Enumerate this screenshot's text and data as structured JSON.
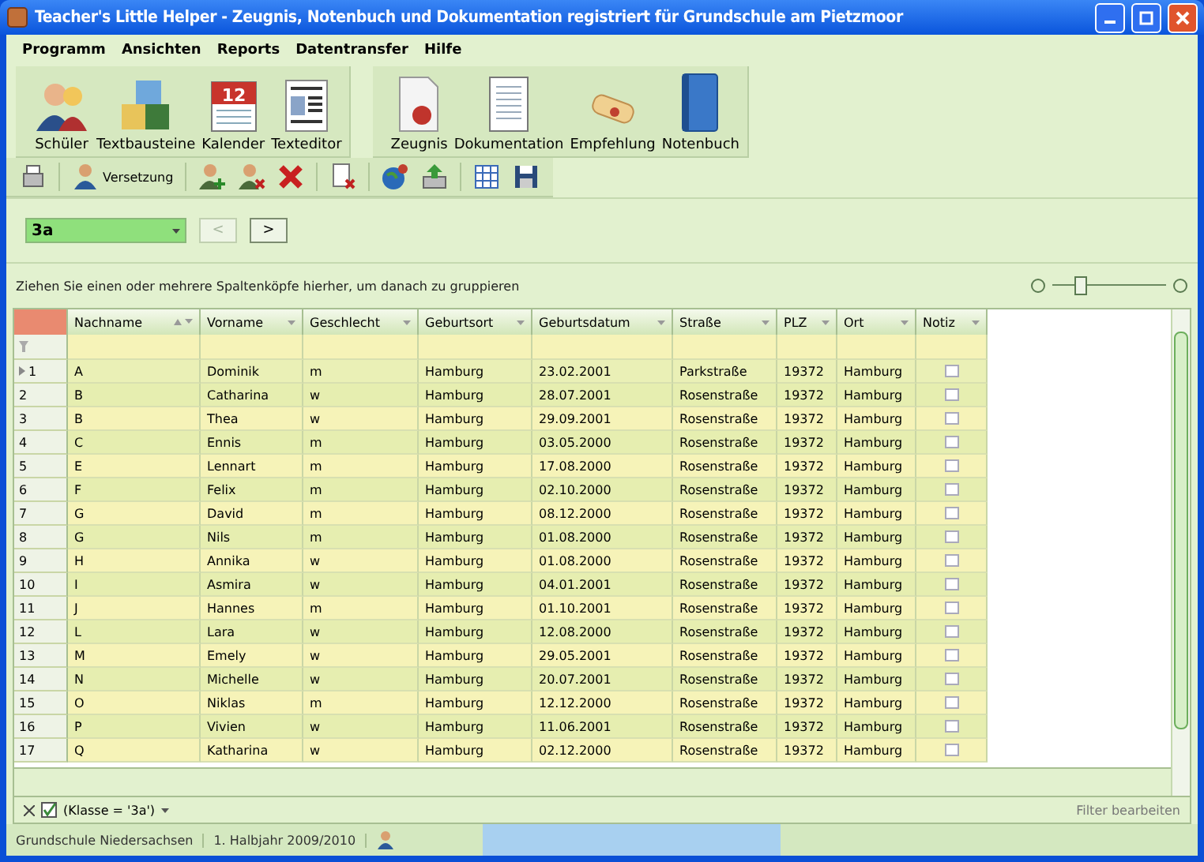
{
  "window": {
    "title": "Teacher's Little Helper - Zeugnis, Notenbuch und Dokumentation registriert für Grundschule am Pietzmoor"
  },
  "menu": [
    "Programm",
    "Ansichten",
    "Reports",
    "Datentransfer",
    "Hilfe"
  ],
  "toolbar_groups": [
    [
      {
        "label": "Schüler"
      },
      {
        "label": "Textbausteine"
      },
      {
        "label": "Kalender",
        "badge": "12"
      },
      {
        "label": "Texteditor"
      }
    ],
    [
      {
        "label": "Zeugnis"
      },
      {
        "label": "Dokumentation"
      },
      {
        "label": "Empfehlung"
      },
      {
        "label": "Notenbuch"
      }
    ]
  ],
  "small_toolbar": [
    {
      "kind": "icon"
    },
    {
      "kind": "labeled",
      "label": "Versetzung"
    },
    {
      "kind": "icon"
    },
    {
      "kind": "icon"
    },
    {
      "kind": "icon"
    },
    {
      "kind": "icon"
    },
    {
      "kind": "icon"
    },
    {
      "kind": "icon"
    },
    {
      "kind": "icon"
    },
    {
      "kind": "icon"
    }
  ],
  "class_selector": {
    "value": "3a",
    "prev": {
      "label": "<",
      "disabled": true
    },
    "next": {
      "label": ">",
      "disabled": false
    }
  },
  "group_panel": {
    "hint": "Ziehen Sie einen oder mehrere Spaltenköpfe hierher, um danach zu gruppieren"
  },
  "zoom_slider": {
    "level": 0.25
  },
  "table": {
    "columns": [
      {
        "label": "Nachname",
        "sorted": true
      },
      {
        "label": "Vorname",
        "sorted": false
      },
      {
        "label": "Geschlecht",
        "sorted": false
      },
      {
        "label": "Geburtsort",
        "sorted": false
      },
      {
        "label": "Geburtsdatum",
        "sorted": false
      },
      {
        "label": "Straße",
        "sorted": false
      },
      {
        "label": "PLZ",
        "sorted": false
      },
      {
        "label": "Ort",
        "sorted": false
      },
      {
        "label": "Notiz",
        "sorted": false
      }
    ],
    "rows": [
      {
        "number": "1",
        "current": true,
        "cells": [
          "A",
          "Dominik",
          "m",
          "Hamburg",
          "23.02.2001",
          "Parkstraße",
          "19372",
          "Hamburg"
        ]
      },
      {
        "number": "2",
        "current": false,
        "cells": [
          "B",
          "Catharina",
          "w",
          "Hamburg",
          "28.07.2001",
          "Rosenstraße",
          "19372",
          "Hamburg"
        ]
      },
      {
        "number": "3",
        "current": false,
        "cells": [
          "B",
          "Thea",
          "w",
          "Hamburg",
          "29.09.2001",
          "Rosenstraße",
          "19372",
          "Hamburg"
        ]
      },
      {
        "number": "4",
        "current": false,
        "cells": [
          "C",
          "Ennis",
          "m",
          "Hamburg",
          "03.05.2000",
          "Rosenstraße",
          "19372",
          "Hamburg"
        ]
      },
      {
        "number": "5",
        "current": false,
        "cells": [
          "E",
          "Lennart",
          "m",
          "Hamburg",
          "17.08.2000",
          "Rosenstraße",
          "19372",
          "Hamburg"
        ]
      },
      {
        "number": "6",
        "current": false,
        "cells": [
          "F",
          "Felix",
          "m",
          "Hamburg",
          "02.10.2000",
          "Rosenstraße",
          "19372",
          "Hamburg"
        ]
      },
      {
        "number": "7",
        "current": false,
        "cells": [
          "G",
          "David",
          "m",
          "Hamburg",
          "08.12.2000",
          "Rosenstraße",
          "19372",
          "Hamburg"
        ]
      },
      {
        "number": "8",
        "current": false,
        "cells": [
          "G",
          "Nils",
          "m",
          "Hamburg",
          "01.08.2000",
          "Rosenstraße",
          "19372",
          "Hamburg"
        ]
      },
      {
        "number": "9",
        "current": false,
        "cells": [
          "H",
          "Annika",
          "w",
          "Hamburg",
          "01.08.2000",
          "Rosenstraße",
          "19372",
          "Hamburg"
        ]
      },
      {
        "number": "10",
        "current": false,
        "cells": [
          "I",
          "Asmira",
          "w",
          "Hamburg",
          "04.01.2001",
          "Rosenstraße",
          "19372",
          "Hamburg"
        ]
      },
      {
        "number": "11",
        "current": false,
        "cells": [
          "J",
          "Hannes",
          "m",
          "Hamburg",
          "01.10.2001",
          "Rosenstraße",
          "19372",
          "Hamburg"
        ]
      },
      {
        "number": "12",
        "current": false,
        "cells": [
          "L",
          "Lara",
          "w",
          "Hamburg",
          "12.08.2000",
          "Rosenstraße",
          "19372",
          "Hamburg"
        ]
      },
      {
        "number": "13",
        "current": false,
        "cells": [
          "M",
          "Emely",
          "w",
          "Hamburg",
          "29.05.2001",
          "Rosenstraße",
          "19372",
          "Hamburg"
        ]
      },
      {
        "number": "14",
        "current": false,
        "cells": [
          "N",
          "Michelle",
          "w",
          "Hamburg",
          "20.07.2001",
          "Rosenstraße",
          "19372",
          "Hamburg"
        ]
      },
      {
        "number": "15",
        "current": false,
        "cells": [
          "O",
          "Niklas",
          "m",
          "Hamburg",
          "12.12.2000",
          "Rosenstraße",
          "19372",
          "Hamburg"
        ]
      },
      {
        "number": "16",
        "current": false,
        "cells": [
          "P",
          "Vivien",
          "w",
          "Hamburg",
          "11.06.2001",
          "Rosenstraße",
          "19372",
          "Hamburg"
        ]
      },
      {
        "number": "17",
        "current": false,
        "cells": [
          "Q",
          "Katharina",
          "w",
          "Hamburg",
          "02.12.2000",
          "Rosenstraße",
          "19372",
          "Hamburg"
        ]
      }
    ]
  },
  "filter_bar": {
    "enabled": true,
    "expression": "(Klasse = '3a')",
    "edit_link": "Filter bearbeiten"
  },
  "status_bar": [
    "Grundschule Niedersachsen",
    "1. Halbjahr 2009/2010"
  ]
}
